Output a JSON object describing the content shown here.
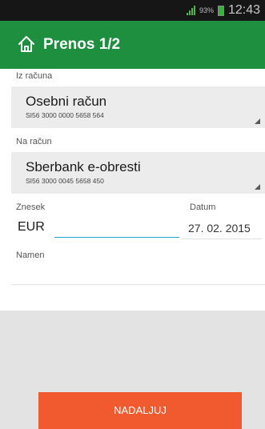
{
  "status_bar": {
    "battery_percent": "93%",
    "battery_level": 0.93,
    "time": "12:43",
    "signal_icon": "signal-icon",
    "battery_icon": "battery-icon"
  },
  "header": {
    "title": "Prenos 1/2",
    "home_icon": "home-icon",
    "background": "#1e8f3f"
  },
  "from_account": {
    "label": "Iz računa",
    "name": "Osebni račun",
    "iban": "SI56 3000 0000 5658 564"
  },
  "to_account": {
    "label": "Na račun",
    "name": "Sberbank e-obresti",
    "iban": "SI56 3000 0045 5658 450"
  },
  "amount": {
    "label": "Znesek",
    "currency": "EUR",
    "value": ""
  },
  "date": {
    "label": "Datum",
    "value": "27. 02. 2015"
  },
  "purpose": {
    "label": "Namen"
  },
  "footer": {
    "continue_label": "NADALJUJ",
    "button_color": "#f05a2e"
  }
}
